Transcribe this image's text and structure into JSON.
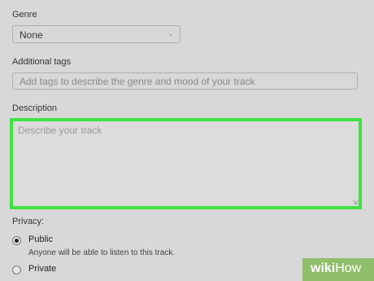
{
  "genre": {
    "label": "Genre",
    "value": "None"
  },
  "tags": {
    "label": "Additional tags",
    "placeholder": "Add tags to describe the genre and mood of your track"
  },
  "description": {
    "label": "Description",
    "placeholder": "Describe your track"
  },
  "privacy": {
    "label": "Privacy:",
    "options": [
      {
        "label": "Public",
        "hint": "Anyone will be able to listen to this track.",
        "checked": true
      },
      {
        "label": "Private",
        "checked": false
      }
    ]
  },
  "watermark": {
    "part1": "wiki",
    "part2": "How"
  },
  "colors": {
    "highlight": "#3fe33f",
    "background": "#d8d8d8",
    "watermark": "#8fbf6a"
  }
}
